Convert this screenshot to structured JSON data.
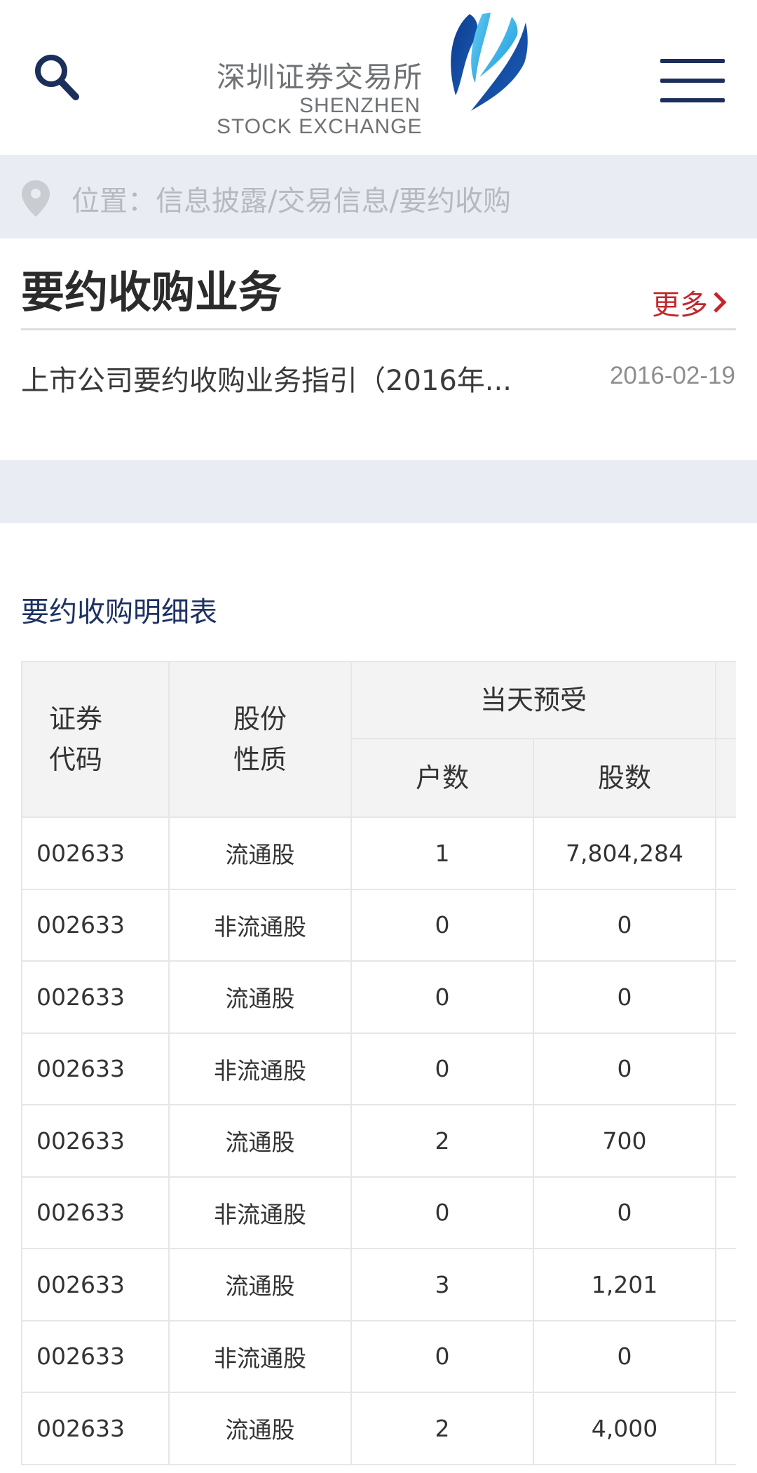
{
  "header": {
    "logo": {
      "name_cn": "深圳证券交易所",
      "name_en_line1": "SHENZHEN",
      "name_en_line2": "STOCK EXCHANGE",
      "mark_colors": [
        "#0b3a8c",
        "#1ea7e1"
      ]
    },
    "search_icon": "search-icon",
    "menu_icon": "hamburger-menu-icon",
    "icon_color": "#1b2f5a"
  },
  "breadcrumb": {
    "icon": "location-pin-icon",
    "text": "位置：信息披露/交易信息/要约收购"
  },
  "business_section": {
    "title": "要约收购业务",
    "more_label": "更多",
    "more_icon": "chevron-right-icon",
    "accent_color": "#c1272d",
    "items": [
      {
        "title": "上市公司要约收购业务指引（2016年...",
        "date": "2016-02-19"
      }
    ]
  },
  "detail_table": {
    "heading": "要约收购明细表",
    "headers": {
      "code": "证券代码",
      "code_line1": "证券",
      "code_line2": "代码",
      "share_type_line1": "股份",
      "share_type_line2": "性质",
      "group_today": "当天预受",
      "households": "户数",
      "shares": "股数"
    },
    "rows": [
      {
        "code": "002633",
        "type": "流通股",
        "households": "1",
        "shares": "7,804,284"
      },
      {
        "code": "002633",
        "type": "非流通股",
        "households": "0",
        "shares": "0"
      },
      {
        "code": "002633",
        "type": "流通股",
        "households": "0",
        "shares": "0"
      },
      {
        "code": "002633",
        "type": "非流通股",
        "households": "0",
        "shares": "0"
      },
      {
        "code": "002633",
        "type": "流通股",
        "households": "2",
        "shares": "700"
      },
      {
        "code": "002633",
        "type": "非流通股",
        "households": "0",
        "shares": "0"
      },
      {
        "code": "002633",
        "type": "流通股",
        "households": "3",
        "shares": "1,201"
      },
      {
        "code": "002633",
        "type": "非流通股",
        "households": "0",
        "shares": "0"
      },
      {
        "code": "002633",
        "type": "流通股",
        "households": "2",
        "shares": "4,000"
      }
    ]
  }
}
